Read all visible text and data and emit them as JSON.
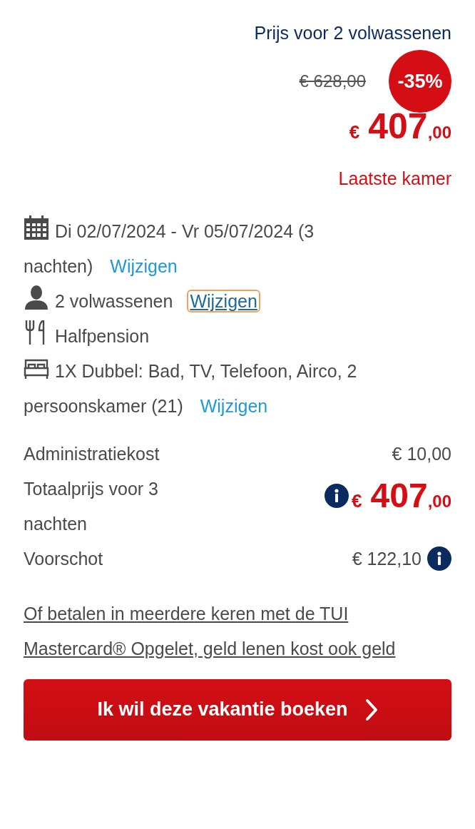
{
  "header": {
    "title": "Prijs voor 2 volwassenen",
    "old_price": "€ 628,00",
    "discount": "-35%",
    "price": {
      "currency": "€",
      "whole": "407",
      "cents": ",00"
    },
    "availability": "Laatste kamer"
  },
  "details": [
    {
      "kind": "calendar",
      "lines": [
        "Di 02/07/2024 - Vr 05/07/2024 (3",
        "nachten)"
      ],
      "link": {
        "label": "Wijzigen",
        "focused": false
      }
    },
    {
      "kind": "person",
      "lines": [
        "2 volwassenen"
      ],
      "link": {
        "label": "Wijzigen",
        "focused": true
      }
    },
    {
      "kind": "meal",
      "lines": [
        "Halfpension"
      ]
    },
    {
      "kind": "bed",
      "lines": [
        "1X Dubbel: Bad, TV, Telefoon, Airco, 2",
        "persoonskamer (21)"
      ],
      "link": {
        "label": "Wijzigen",
        "focused": false
      }
    }
  ],
  "summary": [
    {
      "kind": "plain",
      "label": "Administratiekost",
      "value": "€ 10,00"
    },
    {
      "kind": "total",
      "label": "Totaalprijs voor 3 nachten",
      "price": {
        "currency": "€",
        "whole": "407",
        "cents": ",00"
      }
    },
    {
      "kind": "info_after",
      "label": "Voorschot",
      "value": "€ 122,10"
    }
  ],
  "credit_link": "Of betalen in meerdere keren met de TUI Mastercard® Opgelet, geld lenen kost ook geld",
  "book_button": "Ik wil deze vakantie boeken"
}
